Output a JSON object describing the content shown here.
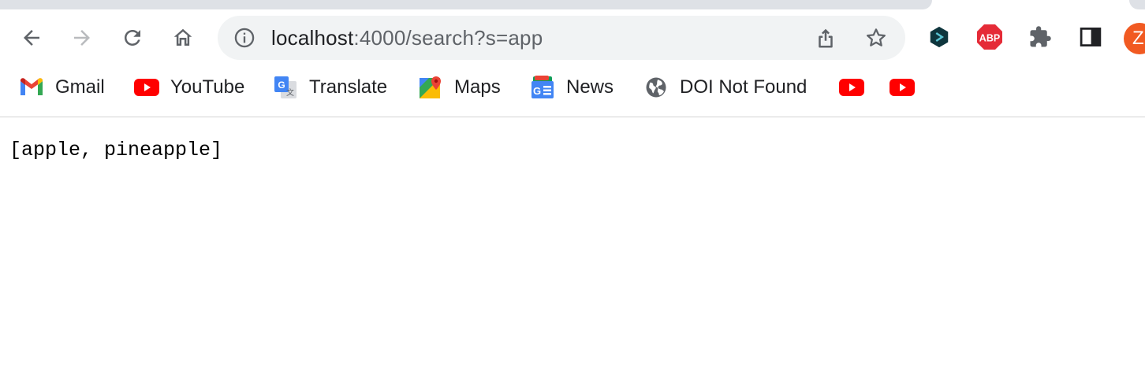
{
  "browser": {
    "address_bar": {
      "host": "localhost",
      "path": ":4000/search?s=app"
    },
    "profile_initial": "Z",
    "extensions": [
      "dashlane-icon",
      "adblock-plus-icon",
      "puzzle-extensions-icon",
      "side-panel-icon"
    ],
    "abp_label": "ABP"
  },
  "bookmarks": [
    {
      "label": "Gmail",
      "icon": "gmail-icon"
    },
    {
      "label": "YouTube",
      "icon": "youtube-icon"
    },
    {
      "label": "Translate",
      "icon": "google-translate-icon"
    },
    {
      "label": "Maps",
      "icon": "google-maps-icon"
    },
    {
      "label": "News",
      "icon": "google-news-icon"
    },
    {
      "label": "DOI Not Found",
      "icon": "globe-icon"
    },
    {
      "label": "",
      "icon": "youtube-icon"
    },
    {
      "label": "",
      "icon": "youtube-icon"
    }
  ],
  "page": {
    "body_text": "[apple, pineapple]"
  },
  "colors": {
    "omnibox_bg": "#f1f3f4",
    "youtube_red": "#ff0000",
    "abp_red": "#e52b37",
    "profile_orange": "#f15a22"
  }
}
